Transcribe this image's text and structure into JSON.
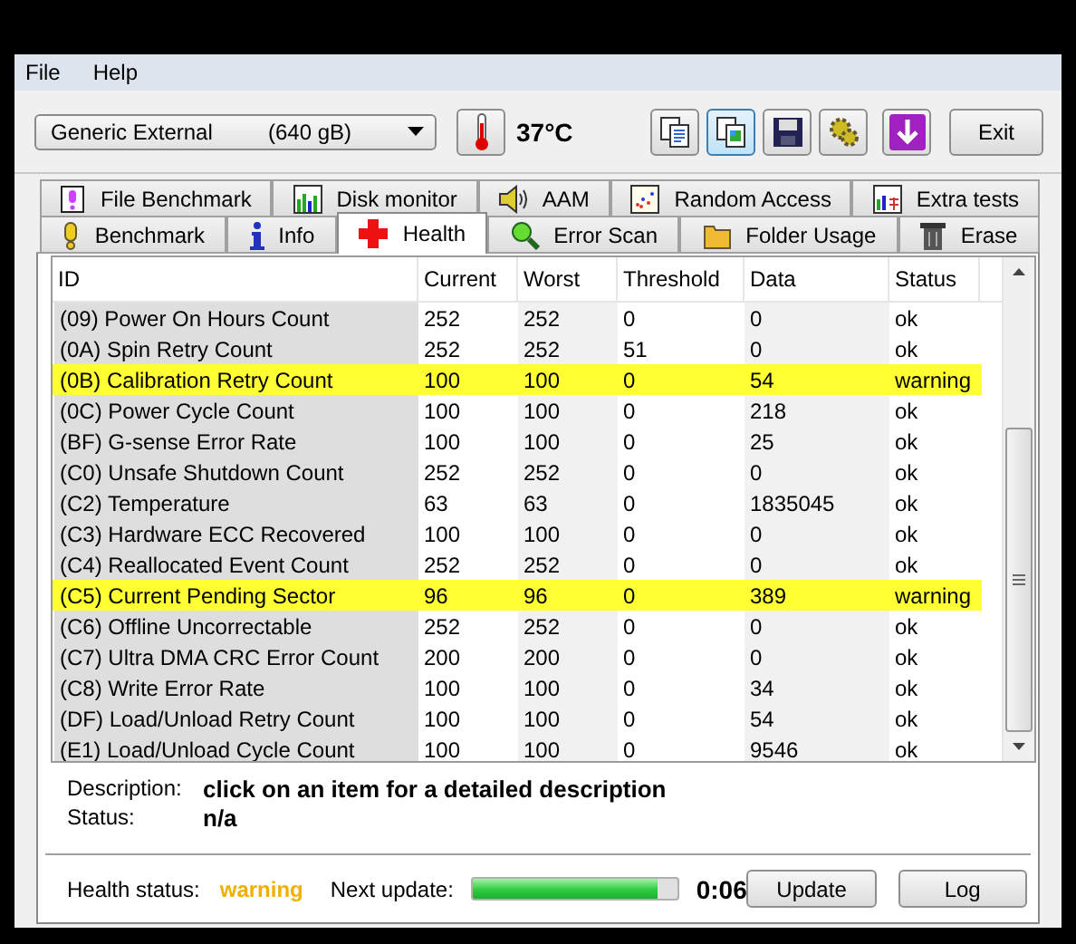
{
  "menu": [
    "File",
    "Help"
  ],
  "device": {
    "name": "Generic External",
    "capacity": "(640 gB)"
  },
  "temperature": "37°C",
  "toolbar_buttons": [
    {
      "kind": "copy-text",
      "selected": false
    },
    {
      "kind": "copy-screen",
      "selected": true
    },
    {
      "kind": "save",
      "selected": false
    },
    {
      "kind": "options",
      "selected": false
    },
    {
      "kind": "download",
      "selected": false
    }
  ],
  "exit_button": "Exit",
  "tab_rows": [
    [
      {
        "label": "File Benchmark",
        "kind": "file",
        "selected": false
      },
      {
        "label": "Disk monitor",
        "kind": "monitor",
        "selected": false
      },
      {
        "label": "AAM",
        "kind": "speaker",
        "selected": false
      },
      {
        "label": "Random Access",
        "kind": "scatter",
        "selected": false
      },
      {
        "label": "Extra tests",
        "kind": "grid",
        "selected": false
      }
    ],
    [
      {
        "label": "Benchmark",
        "kind": "bulb",
        "selected": false
      },
      {
        "label": "Info",
        "kind": "info",
        "selected": false
      },
      {
        "label": "Health",
        "kind": "cross",
        "selected": true
      },
      {
        "label": "Error Scan",
        "kind": "magnifier",
        "selected": false
      },
      {
        "label": "Folder Usage",
        "kind": "folder",
        "selected": false
      },
      {
        "label": "Erase",
        "kind": "trash",
        "selected": false
      }
    ]
  ],
  "table": {
    "columns": [
      "ID",
      "Current",
      "Worst",
      "Threshold",
      "Data",
      "Status"
    ],
    "rows": [
      {
        "id": "(09) Power On Hours Count",
        "current": "252",
        "worst": "252",
        "threshold": "0",
        "data": "0",
        "status": "ok",
        "highlighted": false
      },
      {
        "id": "(0A) Spin Retry Count",
        "current": "252",
        "worst": "252",
        "threshold": "51",
        "data": "0",
        "status": "ok",
        "highlighted": false
      },
      {
        "id": "(0B) Calibration Retry Count",
        "current": "100",
        "worst": "100",
        "threshold": "0",
        "data": "54",
        "status": "warning",
        "highlighted": true
      },
      {
        "id": "(0C) Power Cycle Count",
        "current": "100",
        "worst": "100",
        "threshold": "0",
        "data": "218",
        "status": "ok",
        "highlighted": false
      },
      {
        "id": "(BF) G-sense Error Rate",
        "current": "100",
        "worst": "100",
        "threshold": "0",
        "data": "25",
        "status": "ok",
        "highlighted": false
      },
      {
        "id": "(C0) Unsafe Shutdown Count",
        "current": "252",
        "worst": "252",
        "threshold": "0",
        "data": "0",
        "status": "ok",
        "highlighted": false
      },
      {
        "id": "(C2) Temperature",
        "current": "63",
        "worst": "63",
        "threshold": "0",
        "data": "1835045",
        "status": "ok",
        "highlighted": false
      },
      {
        "id": "(C3) Hardware ECC Recovered",
        "current": "100",
        "worst": "100",
        "threshold": "0",
        "data": "0",
        "status": "ok",
        "highlighted": false
      },
      {
        "id": "(C4) Reallocated Event Count",
        "current": "252",
        "worst": "252",
        "threshold": "0",
        "data": "0",
        "status": "ok",
        "highlighted": false
      },
      {
        "id": "(C5) Current Pending Sector",
        "current": "96",
        "worst": "96",
        "threshold": "0",
        "data": "389",
        "status": "warning",
        "highlighted": true
      },
      {
        "id": "(C6) Offline Uncorrectable",
        "current": "252",
        "worst": "252",
        "threshold": "0",
        "data": "0",
        "status": "ok",
        "highlighted": false
      },
      {
        "id": "(C7) Ultra DMA CRC Error Count",
        "current": "200",
        "worst": "200",
        "threshold": "0",
        "data": "0",
        "status": "ok",
        "highlighted": false
      },
      {
        "id": "(C8) Write Error Rate",
        "current": "100",
        "worst": "100",
        "threshold": "0",
        "data": "34",
        "status": "ok",
        "highlighted": false
      },
      {
        "id": "(DF) Load/Unload Retry Count",
        "current": "100",
        "worst": "100",
        "threshold": "0",
        "data": "54",
        "status": "ok",
        "highlighted": false
      },
      {
        "id": "(E1) Load/Unload Cycle Count",
        "current": "100",
        "worst": "100",
        "threshold": "0",
        "data": "9546",
        "status": "ok",
        "highlighted": false
      }
    ]
  },
  "description": {
    "label": "Description:",
    "value": "click on an item for a detailed description"
  },
  "status": {
    "label": "Status:",
    "value": "n/a"
  },
  "health_status": {
    "label": "Health status:",
    "value": "warning"
  },
  "next_update": {
    "label": "Next update:",
    "level": 0.9,
    "time": "0:06"
  },
  "buttons": [
    "Update",
    "Log"
  ]
}
